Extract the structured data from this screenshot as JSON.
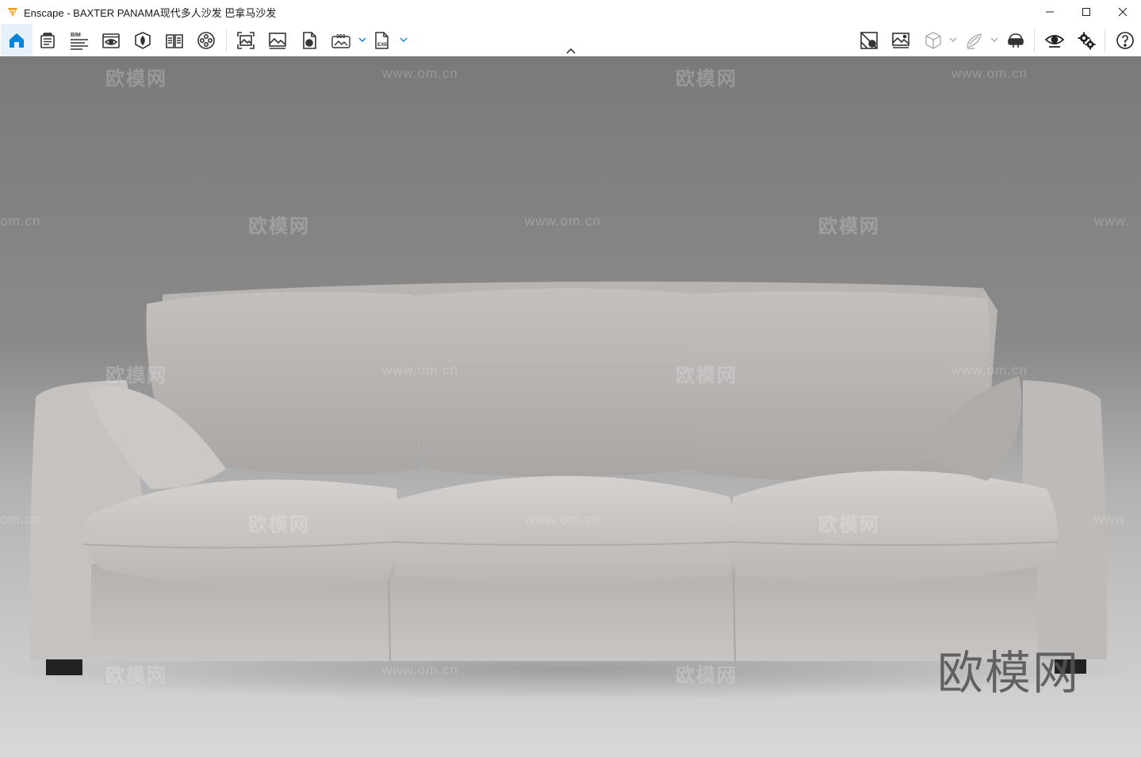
{
  "window": {
    "title": "Enscape - BAXTER PANAMA现代多人沙发 巴拿马沙发",
    "controls": [
      "minimize-icon",
      "maximize-icon",
      "close-icon"
    ]
  },
  "toolbar": {
    "left": [
      {
        "name": "home-icon",
        "active": true
      },
      {
        "name": "asset-library-icon"
      },
      {
        "name": "bim-icon",
        "text": "BIM"
      },
      {
        "name": "visual-settings-icon"
      },
      {
        "name": "material-editor-icon"
      },
      {
        "name": "book-icon"
      },
      {
        "name": "video-editor-icon"
      },
      {
        "name": "screenshot-icon"
      },
      {
        "name": "batch-render-icon"
      },
      {
        "name": "upload-icon"
      },
      {
        "name": "panorama-360-icon",
        "text": "360"
      },
      {
        "name": "export-exe-icon",
        "text": "EXE"
      }
    ],
    "right": [
      {
        "name": "views-icon"
      },
      {
        "name": "view-management-icon"
      },
      {
        "name": "cube-icon"
      },
      {
        "name": "sketch-icon"
      },
      {
        "name": "vr-headset-icon"
      },
      {
        "name": "eye-icon"
      },
      {
        "name": "settings-icon"
      },
      {
        "name": "help-icon"
      }
    ]
  },
  "watermark": {
    "brand": "欧模网",
    "url": "www.om.cn",
    "url_fragment_left": "om.cn",
    "url_fragment_right": "www."
  },
  "colors": {
    "accent": "#0a84d6",
    "logo": "#f39c12",
    "sofa": "#c9c6c3",
    "background_top": "#7b7b7b",
    "background_floor": "#d4d4d4"
  }
}
